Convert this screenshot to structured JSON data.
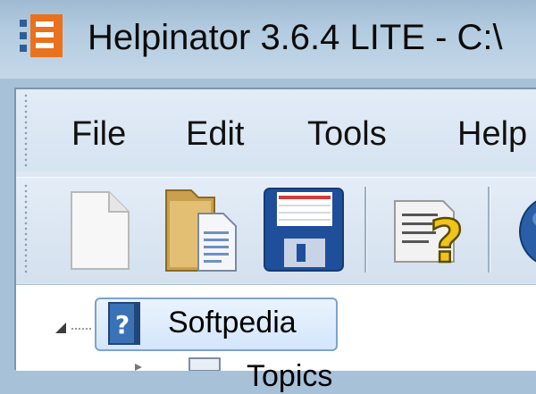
{
  "window": {
    "title": "Helpinator 3.6.4 LITE - C:\\"
  },
  "menu": {
    "items": [
      "File",
      "Edit",
      "Tools",
      "Help"
    ]
  },
  "toolbar": {
    "buttons": [
      {
        "name": "new-document",
        "icon": "new-document-icon"
      },
      {
        "name": "open-folder",
        "icon": "open-folder-icon"
      },
      {
        "name": "save",
        "icon": "floppy-disk-icon"
      },
      {
        "name": "help-topic",
        "icon": "help-document-icon"
      },
      {
        "name": "globe",
        "icon": "globe-icon"
      }
    ]
  },
  "tree": {
    "root": {
      "label": "Softpedia",
      "selected": true,
      "expanded": true
    },
    "child": {
      "label": "Topics"
    }
  },
  "colors": {
    "titlebar": "#b4cce0",
    "client": "#dde8f3",
    "selection_border": "#7da2ce"
  }
}
